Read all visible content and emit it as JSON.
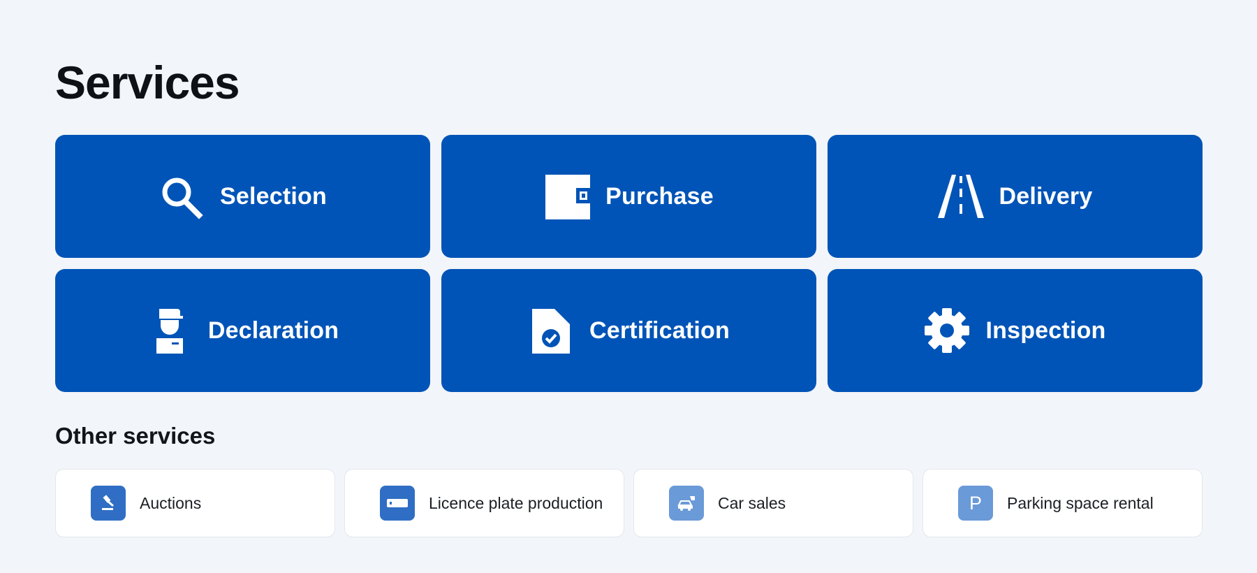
{
  "page": {
    "title": "Services",
    "subtitle": "Other services"
  },
  "colors": {
    "tile_bg": "#0054b7",
    "icon_dark": "#2f6ec4",
    "icon_light": "#6a9ad8",
    "background": "#f2f5f9"
  },
  "services": [
    {
      "label": "Selection",
      "icon": "search-icon"
    },
    {
      "label": "Purchase",
      "icon": "wallet-icon"
    },
    {
      "label": "Delivery",
      "icon": "road-icon"
    },
    {
      "label": "Declaration",
      "icon": "customs-officer-icon"
    },
    {
      "label": "Certification",
      "icon": "certificate-icon"
    },
    {
      "label": "Inspection",
      "icon": "gear-icon"
    }
  ],
  "other_services": [
    {
      "label": "Auctions",
      "icon": "gavel-icon"
    },
    {
      "label": "Licence plate production",
      "icon": "licence-plate-icon"
    },
    {
      "label": "Car sales",
      "icon": "car-sale-icon"
    },
    {
      "label": "Parking space rental",
      "icon": "parking-icon",
      "glyph": "P"
    }
  ]
}
